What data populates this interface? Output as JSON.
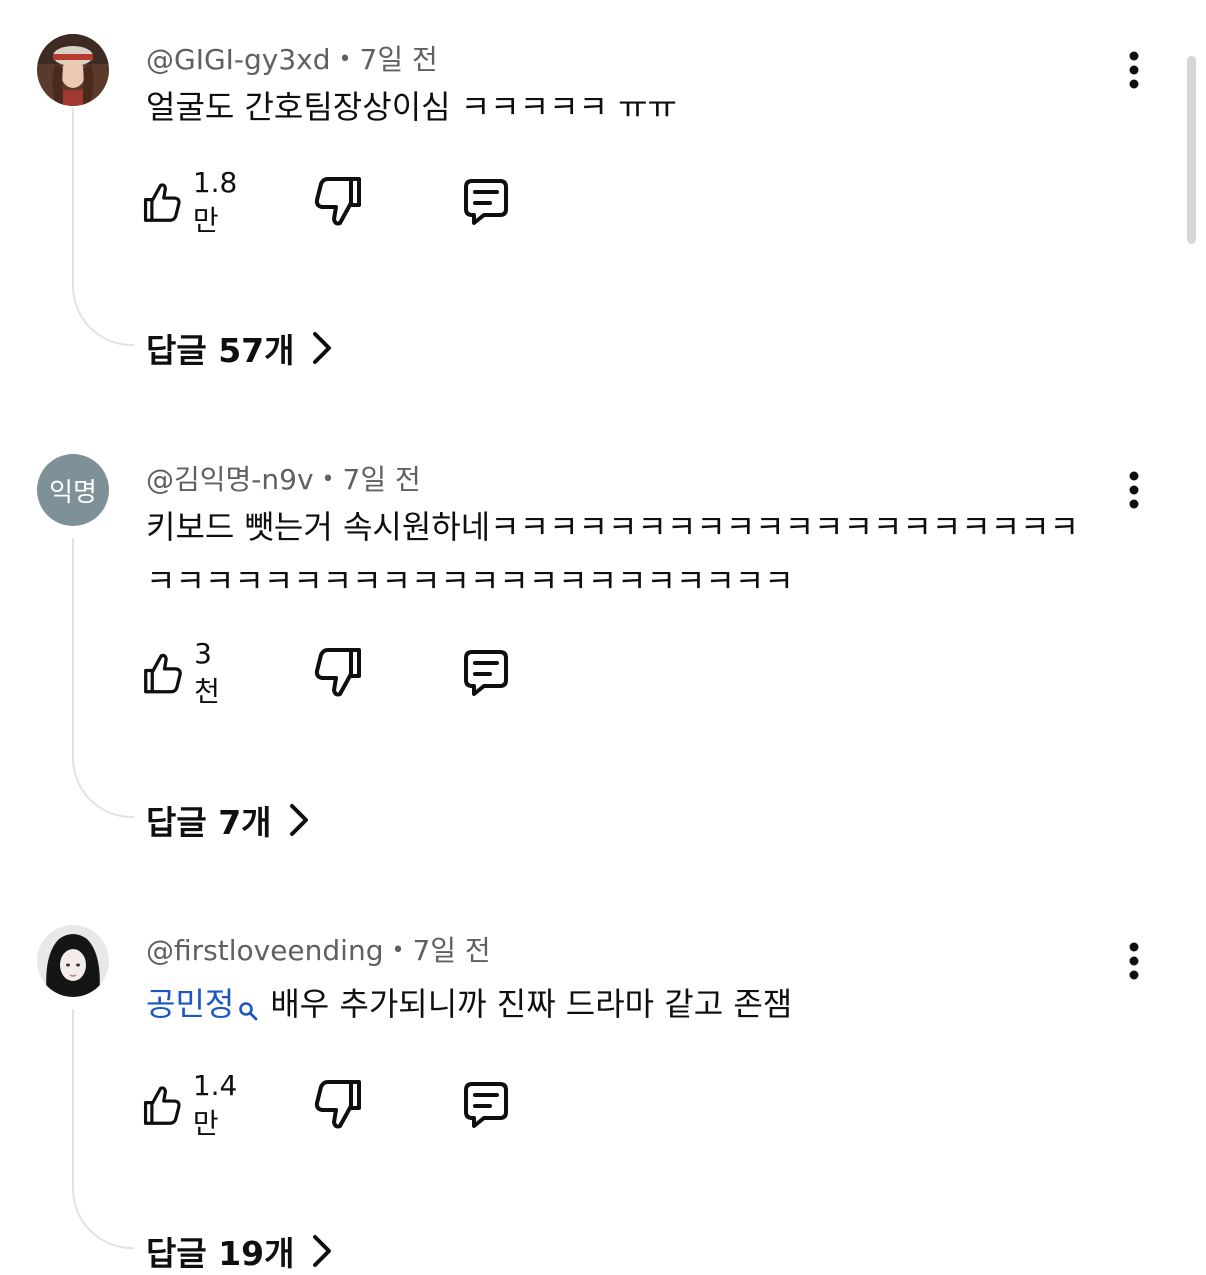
{
  "comments": [
    {
      "author": "@GIGI-gy3xd",
      "time": "7일 전",
      "text": "얼굴도 간호팀장상이심 ㅋㅋㅋㅋㅋ ㅠㅠ",
      "likes": "1.8만",
      "replies_label": "답글 57개"
    },
    {
      "author": "@김익명-n9v",
      "avatar_text": "익명",
      "avatar_color": "#7f9198",
      "time": "7일 전",
      "text": "키보드 뺏는거 속시원하네ㅋㅋㅋㅋㅋㅋㅋㅋㅋㅋㅋㅋㅋㅋㅋㅋㅋㅋㅋㅋㅋㅋㅋㅋㅋㅋㅋㅋㅋㅋㅋㅋㅋㅋㅋㅋㅋㅋㅋㅋㅋㅋ",
      "likes": "3천",
      "replies_label": "답글 7개"
    },
    {
      "author": "@firstloveending",
      "time": "7일 전",
      "mention": "공민정",
      "text": "배우 추가되니까 진짜 드라마 같고 존잼",
      "likes": "1.4만",
      "replies_label": "답글 19개"
    }
  ],
  "colors": {
    "mention": "#1a56c4",
    "meta": "#606060",
    "thread_line": "#e2e2e2"
  },
  "icons": [
    "like-icon",
    "dislike-icon",
    "reply-icon",
    "more-vert-icon",
    "chevron-right-icon",
    "search-icon"
  ]
}
